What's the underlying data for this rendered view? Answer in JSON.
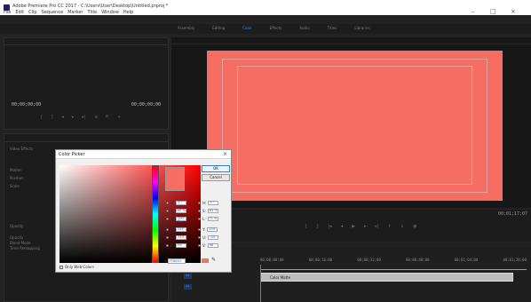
{
  "window": {
    "title": "Adobe Premiere Pro CC 2017 - C:\\Users\\User\\Desktop\\Untitled.prproj *",
    "menu": [
      "File",
      "Edit",
      "Clip",
      "Sequence",
      "Marker",
      "Title",
      "Window",
      "Help"
    ],
    "controls": {
      "minimize": "–",
      "maximize": "□",
      "close": "×"
    }
  },
  "workspace_tabs": [
    "Assembly",
    "Editing",
    "Color",
    "Effects",
    "Audio",
    "Titles",
    "Libraries"
  ],
  "active_workspace": "Color",
  "source_monitor": {
    "timecode_in": "00;00;00;00",
    "timecode_out": "00;00;00;00"
  },
  "program_monitor": {
    "frame_color": "#f66e63",
    "timecode": "00;01;17;07"
  },
  "effects_panel": {
    "items": [
      "Video Effects",
      "Motion",
      "Position",
      "Scale",
      "Opacity",
      "Time Remapping",
      "Opacity",
      "Blend Mode"
    ]
  },
  "timeline": {
    "ruler": [
      "00;00;00;00",
      "00;00;16;00",
      "00;00;32;00",
      "00;00;48;00",
      "00;01;04;00",
      "00;01;20;00"
    ],
    "clip_label": "Color Matte",
    "tracks": [
      "V1",
      "A1"
    ]
  },
  "color_picker": {
    "title": "Color Picker",
    "ok_label": "OK",
    "cancel_label": "Cancel",
    "current_color": "#f66e63",
    "values": [
      {
        "label": "H:",
        "value": "5 °"
      },
      {
        "label": "H:",
        "value": "5 °"
      },
      {
        "label": "S:",
        "value": "60 %"
      },
      {
        "label": "S:",
        "value": "61 %"
      },
      {
        "label": "B:",
        "value": "100 %"
      },
      {
        "label": "L:",
        "value": "71 %"
      },
      {
        "label": "R:",
        "value": "255"
      },
      {
        "label": "Y:",
        "value": "159"
      },
      {
        "label": "G:",
        "value": "110"
      },
      {
        "label": "U:",
        "value": "-45"
      },
      {
        "label": "B:",
        "value": "99"
      },
      {
        "label": "V:",
        "value": "96"
      }
    ],
    "hex_label": "#",
    "hex": "FF6E63",
    "web_only": "Only Web Colors"
  }
}
